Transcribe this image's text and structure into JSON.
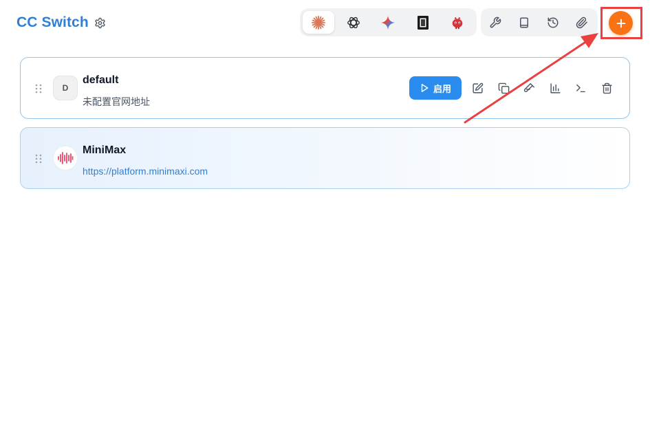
{
  "header": {
    "title": "CC Switch",
    "settings_icon": "gear-icon"
  },
  "app_switcher": {
    "tabs": [
      {
        "name": "claude",
        "icon": "claude-starburst-icon",
        "active": true
      },
      {
        "name": "codex",
        "icon": "openai-knot-icon",
        "active": false
      },
      {
        "name": "gemini",
        "icon": "gemini-sparkle-icon",
        "active": false
      },
      {
        "name": "app-4",
        "icon": "black-panel-icon",
        "active": false
      },
      {
        "name": "app-5",
        "icon": "red-mascot-icon",
        "active": false
      }
    ]
  },
  "toolbar": {
    "buttons": [
      {
        "name": "wrench",
        "icon": "wrench-icon"
      },
      {
        "name": "book",
        "icon": "book-icon"
      },
      {
        "name": "history",
        "icon": "history-icon"
      },
      {
        "name": "paperclip",
        "icon": "paperclip-icon"
      }
    ],
    "add_icon": "plus-icon"
  },
  "providers": [
    {
      "name": "default",
      "icon_letter": "D",
      "subtitle": "未配置官网地址",
      "enable_label": "启用",
      "actions": [
        "edit-icon",
        "copy-icon",
        "test-icon",
        "stats-icon",
        "terminal-icon",
        "trash-icon"
      ]
    },
    {
      "name": "MiniMax",
      "icon": "minimax-wave-icon",
      "url": "https://platform.minimaxi.com"
    }
  ],
  "colors": {
    "brand": "#2f7fd8",
    "accent_orange": "#f97316",
    "enable_blue": "#2b8cf0",
    "highlight_red": "#e8413f",
    "minimax_pink": "#e8476a"
  }
}
